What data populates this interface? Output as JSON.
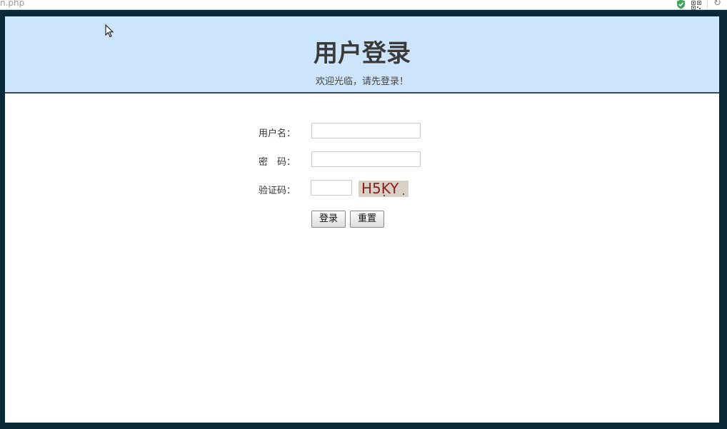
{
  "browser": {
    "url_fragment": "n.php"
  },
  "header": {
    "title": "用户登录",
    "subtitle": "欢迎光临，请先登录！"
  },
  "form": {
    "username": {
      "label": "用户名：",
      "value": ""
    },
    "password": {
      "label": "密　码：",
      "value": ""
    },
    "captcha": {
      "label": "验证码：",
      "value": "",
      "image_text": "H5KY"
    },
    "login_button": "登录",
    "reset_button": "重置"
  },
  "colors": {
    "header_bg": "#cde5fb",
    "frame_bg": "#0b2a38",
    "captcha_text": "#8b1f1f"
  }
}
